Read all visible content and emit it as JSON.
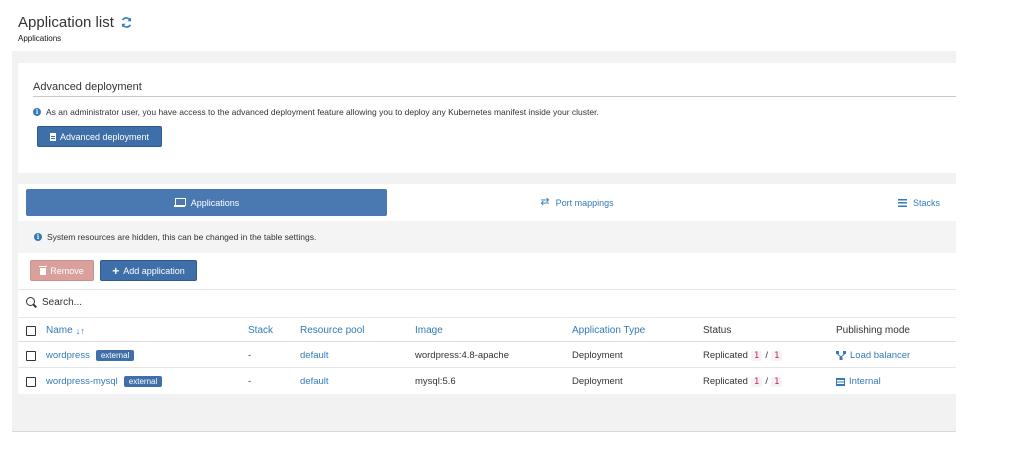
{
  "header": {
    "title": "Application list",
    "breadcrumb": "Applications"
  },
  "advanced": {
    "title": "Advanced deployment",
    "info": "As an administrator user, you have access to the advanced deployment feature allowing you to deploy any Kubernetes manifest inside your cluster.",
    "button_label": "Advanced deployment"
  },
  "tabs": [
    {
      "label": "Applications",
      "active": true
    },
    {
      "label": "Port mappings",
      "active": false
    },
    {
      "label": "Stacks",
      "active": false
    }
  ],
  "system_info": "System resources are hidden, this can be changed in the table settings.",
  "actions": {
    "remove_label": "Remove",
    "add_label": "Add application"
  },
  "search": {
    "placeholder": "Search..."
  },
  "table": {
    "columns": [
      "Name",
      "Stack",
      "Resource pool",
      "Image",
      "Application Type",
      "Status",
      "Publishing mode"
    ],
    "rows": [
      {
        "name": "wordpress",
        "badge": "external",
        "stack": "-",
        "pool": "default",
        "image": "wordpress:4.8-apache",
        "type": "Deployment",
        "status": "Replicated",
        "running": "1",
        "sep": "/",
        "total": "1",
        "publishing": "Load balancer",
        "publishing_icon": "load-balancer-icon"
      },
      {
        "name": "wordpress-mysql",
        "badge": "external",
        "stack": "-",
        "pool": "default",
        "image": "mysql:5.6",
        "type": "Deployment",
        "status": "Replicated",
        "running": "1",
        "sep": "/",
        "total": "1",
        "publishing": "Internal",
        "publishing_icon": "list-icon"
      }
    ]
  },
  "colors": {
    "primary": "#3e6fa8",
    "link": "#337ab7",
    "danger_light": "#d9a09c",
    "code_text": "#c7254e"
  }
}
